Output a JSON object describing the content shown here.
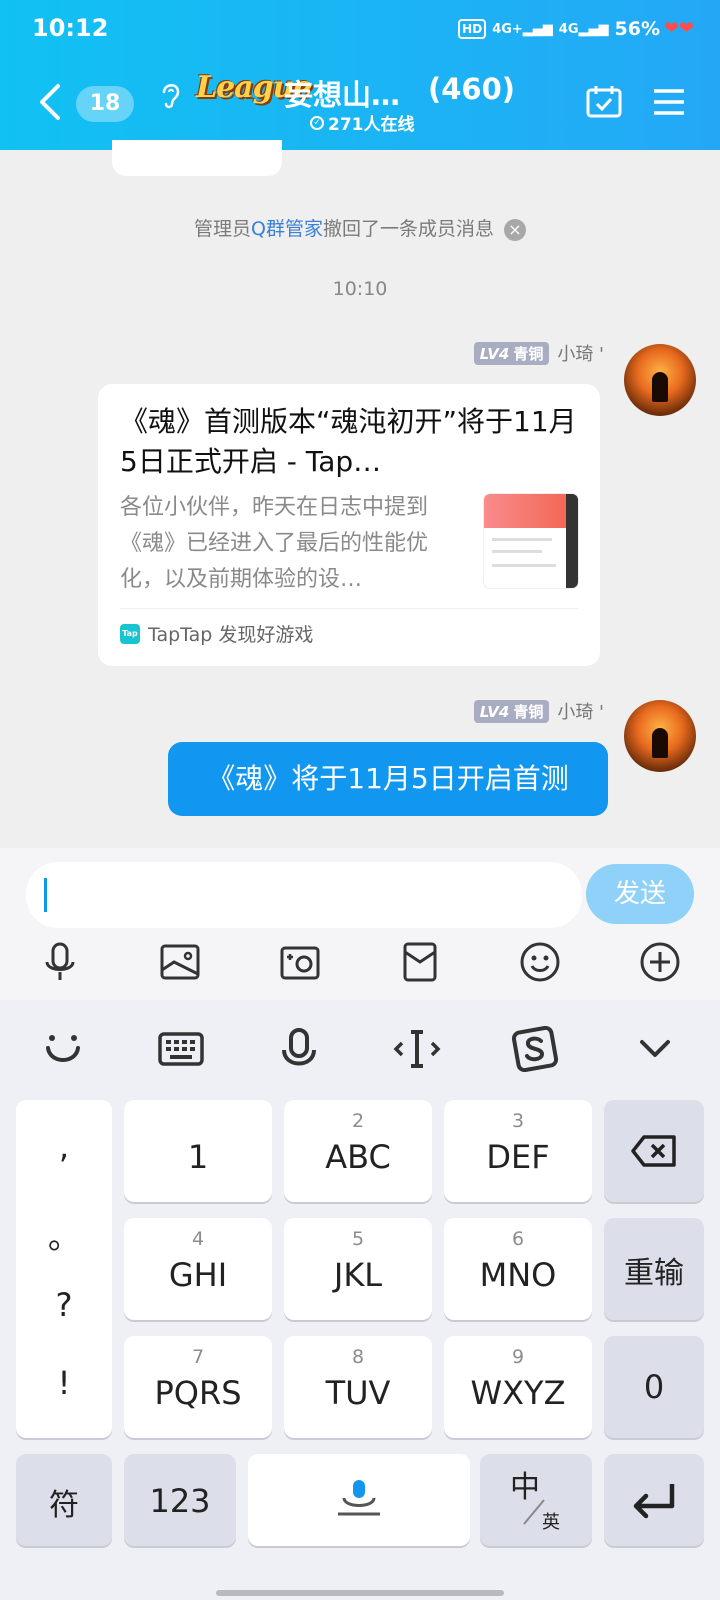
{
  "status_bar": {
    "time": "10:12",
    "hd": "HD",
    "net1": "4G+",
    "net2": "4G",
    "battery": "56%"
  },
  "header": {
    "unread_count": "18",
    "logo_text": "League",
    "group_name": "妄想山…",
    "member_count": "(460)",
    "online_text": "271人在线"
  },
  "chat": {
    "system_message": {
      "prefix": "管理员",
      "link": "Q群管家",
      "suffix": "撤回了一条成员消息"
    },
    "timestamp": "10:10",
    "messages": [
      {
        "level": "LV4",
        "rank": "青铜",
        "sender": "小琦 '",
        "card": {
          "title": "《魂》首测版本“魂沌初开”将于11月5日正式开启 - Tap…",
          "description": "各位小伙伴，昨天在日志中提到《魂》已经进入了最后的性能优化，以及前期体验的设…",
          "source": "TapTap 发现好游戏",
          "source_icon": "Tap"
        }
      },
      {
        "level": "LV4",
        "rank": "青铜",
        "sender": "小琦 '",
        "text": "《魂》将于11月5日开启首测"
      }
    ]
  },
  "input": {
    "value": "",
    "send_label": "发送"
  },
  "toolbar_icons": [
    "microphone-icon",
    "image-icon",
    "camera-icon",
    "red-packet-icon",
    "emoji-icon",
    "plus-icon"
  ],
  "keyboard": {
    "toolbar_icons": [
      "smile-icon",
      "keyboard-icon",
      "voice-icon",
      "cursor-icon",
      "sogou-icon",
      "collapse-icon"
    ],
    "punctuation": [
      ",",
      "。",
      "?",
      "!"
    ],
    "keys": [
      {
        "num": "",
        "main": "1"
      },
      {
        "num": "2",
        "main": "ABC"
      },
      {
        "num": "3",
        "main": "DEF"
      },
      {
        "num": "4",
        "main": "GHI"
      },
      {
        "num": "5",
        "main": "JKL"
      },
      {
        "num": "6",
        "main": "MNO"
      },
      {
        "num": "7",
        "main": "PQRS"
      },
      {
        "num": "8",
        "main": "TUV"
      },
      {
        "num": "9",
        "main": "WXYZ"
      }
    ],
    "reenter": "重输",
    "zero": "0",
    "symbols": "符",
    "numbers": "123",
    "lang_main": "中",
    "lang_sub": "英"
  }
}
